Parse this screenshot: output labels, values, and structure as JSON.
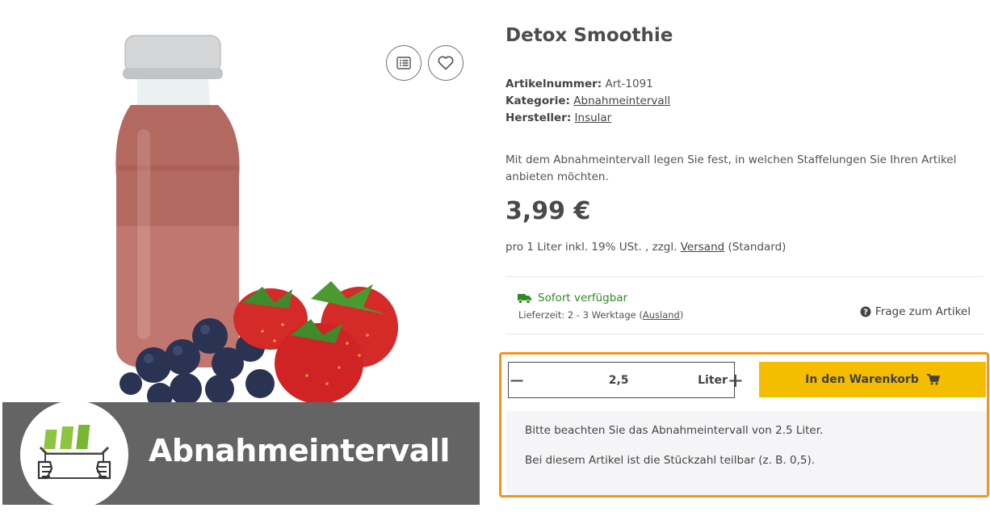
{
  "product": {
    "title": "Detox Smoothie",
    "meta": {
      "artikelnummer_label": "Artikelnummer:",
      "artikelnummer_value": "Art-1091",
      "kategorie_label": "Kategorie:",
      "kategorie_value": "Abnahmeintervall",
      "hersteller_label": "Hersteller:",
      "hersteller_value": "Insular"
    },
    "description": "Mit dem Abnahmeintervall legen Sie fest, in welchen Staffelungen Sie Ihren Artikel anbieten möchten.",
    "price": "3,99 €",
    "tax": {
      "prefix": "pro 1 Liter inkl. 19% USt. , zzgl.",
      "link": "Versand",
      "suffix": "(Standard)"
    }
  },
  "image": {
    "banner_title": "Abnahmeintervall"
  },
  "actions": {
    "compare_icon": "list-icon",
    "wishlist_icon": "heart-icon"
  },
  "delivery": {
    "availability": "Sofort verfügbar",
    "lieferzeit_prefix": "Lieferzeit: 2 - 3 Werktage (",
    "lieferzeit_link": "Ausland",
    "lieferzeit_suffix": ")",
    "question": "Frage zum Artikel",
    "colors": {
      "available": "#2e8b22"
    }
  },
  "purchase": {
    "quantity_value": "2,5",
    "unit": "Liter",
    "minus": "−",
    "plus": "+",
    "cart_label": "In den Warenkorb",
    "colors": {
      "cart_button": "#f4bd00",
      "highlight_border": "#f0961e"
    }
  },
  "notes": {
    "interval": "Bitte beachten Sie das Abnahmeintervall von 2.5 Liter.",
    "divisible": "Bei diesem Artikel ist die Stückzahl teilbar (z. B. 0,5)."
  }
}
